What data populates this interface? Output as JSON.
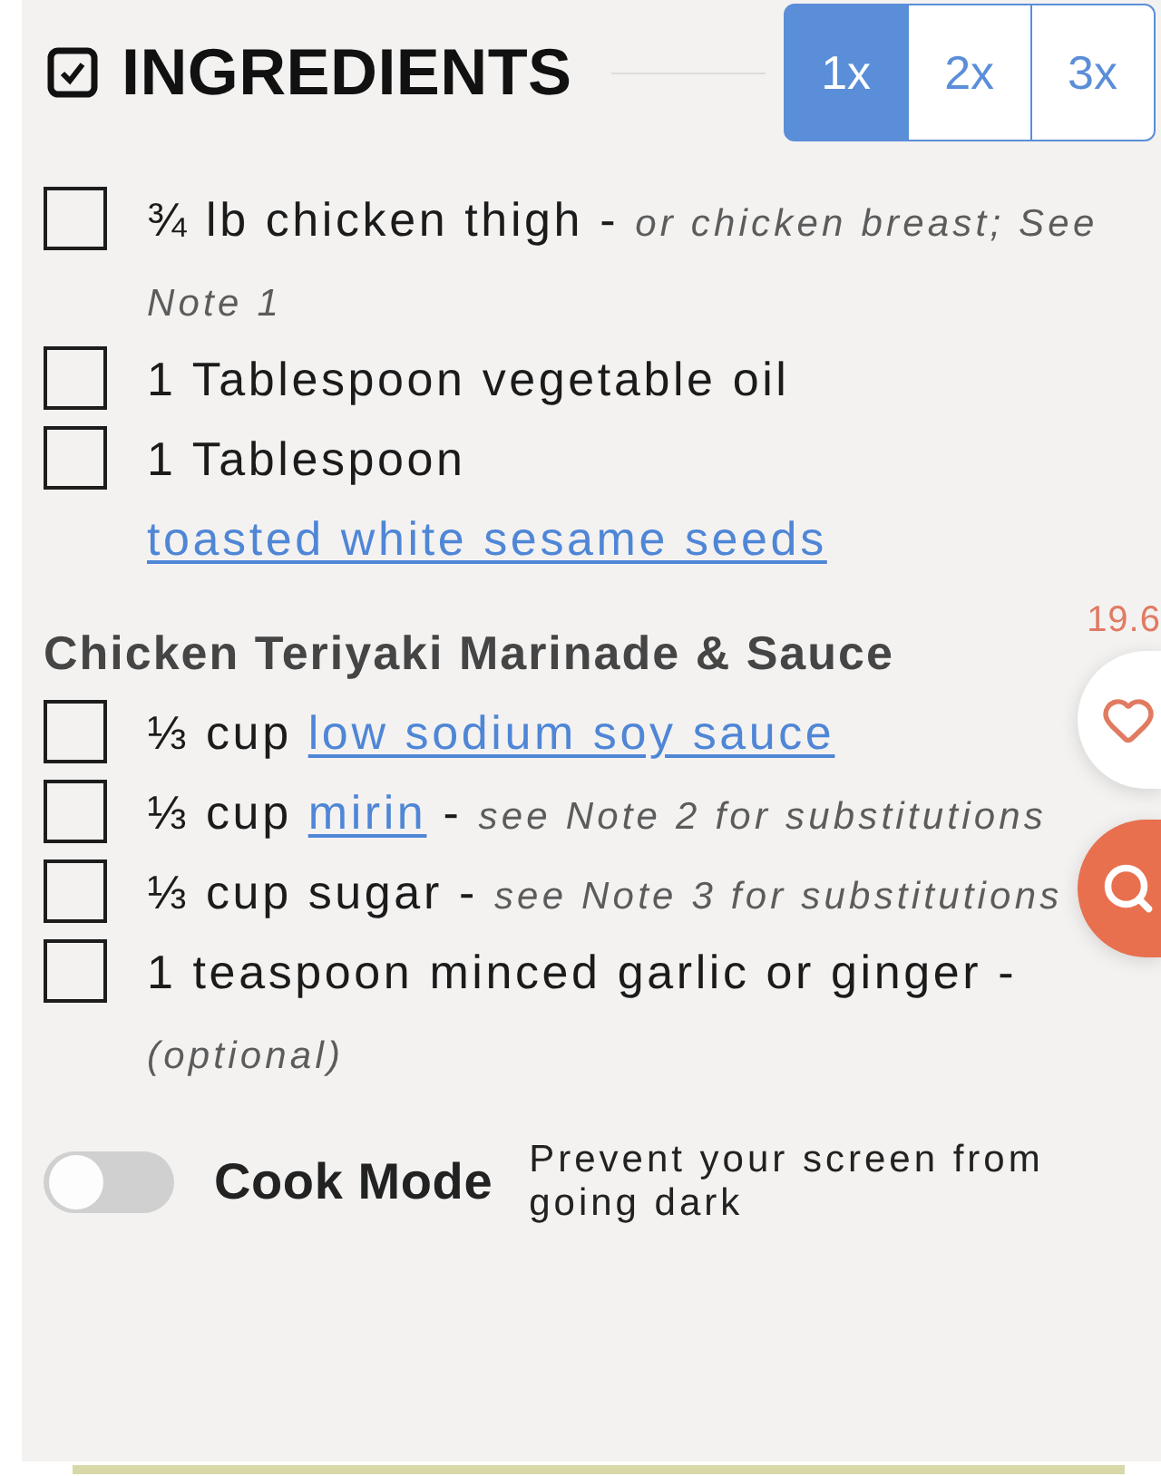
{
  "header": {
    "title": "INGREDIENTS"
  },
  "multipliers": [
    {
      "label": "1x",
      "selected": true
    },
    {
      "label": "2x",
      "selected": false
    },
    {
      "label": "3x",
      "selected": false
    }
  ],
  "ingredient_groups": [
    {
      "items": [
        {
          "checked": false,
          "quantity": "¾ lb",
          "name": "chicken thigh",
          "link": false,
          "separator": "-",
          "notes": "or chicken breast; See Note 1"
        },
        {
          "checked": false,
          "quantity": "1 Tablespoon",
          "name": "vegetable oil",
          "link": false
        },
        {
          "checked": false,
          "quantity": "1 Tablespoon",
          "name": "toasted white sesame seeds",
          "link": true
        }
      ]
    },
    {
      "heading": "Chicken Teriyaki Marinade & Sauce",
      "items": [
        {
          "checked": false,
          "quantity": "⅓ cup",
          "name": "low sodium soy sauce",
          "link": true
        },
        {
          "checked": false,
          "quantity": "⅓ cup",
          "name": "mirin",
          "link": true,
          "separator": "-",
          "notes": "see Note 2 for substitutions"
        },
        {
          "checked": false,
          "quantity": "⅓ cup",
          "name": "sugar",
          "link": false,
          "separator": "-",
          "notes": "see Note 3 for substitutions"
        },
        {
          "checked": false,
          "quantity": "1 teaspoon",
          "name": "minced garlic or ginger",
          "link": false,
          "separator": "-",
          "notes": "(optional)"
        }
      ]
    }
  ],
  "cook_mode": {
    "label": "Cook Mode",
    "description": "Prevent your screen from going dark",
    "on": false
  },
  "favorite": {
    "count": "19.6"
  }
}
